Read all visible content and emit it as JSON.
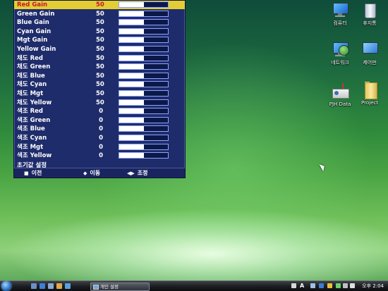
{
  "osd": {
    "items": [
      {
        "label": "Red Gain",
        "value": "50",
        "level": 0.5,
        "selected": true
      },
      {
        "label": "Green Gain",
        "value": "50",
        "level": 0.5
      },
      {
        "label": "Blue Gain",
        "value": "50",
        "level": 0.5
      },
      {
        "label": "Cyan Gain",
        "value": "50",
        "level": 0.5
      },
      {
        "label": "Mgt Gain",
        "value": "50",
        "level": 0.5
      },
      {
        "label": "Yellow Gain",
        "value": "50",
        "level": 0.5
      },
      {
        "label": "채도 Red",
        "value": "50",
        "level": 0.5
      },
      {
        "label": "채도 Green",
        "value": "50",
        "level": 0.5
      },
      {
        "label": "채도 Blue",
        "value": "50",
        "level": 0.5
      },
      {
        "label": "채도 Cyan",
        "value": "50",
        "level": 0.5
      },
      {
        "label": "채도 Mgt",
        "value": "50",
        "level": 0.5
      },
      {
        "label": "채도 Yellow",
        "value": "50",
        "level": 0.5
      },
      {
        "label": "색조 Red",
        "value": "0",
        "level": 0.5
      },
      {
        "label": "색조 Green",
        "value": "0",
        "level": 0.5
      },
      {
        "label": "색조 Blue",
        "value": "0",
        "level": 0.5
      },
      {
        "label": "색조 Cyan",
        "value": "0",
        "level": 0.5
      },
      {
        "label": "색조 Mgt",
        "value": "0",
        "level": 0.5
      },
      {
        "label": "색조 Yellow",
        "value": "0",
        "level": 0.5
      }
    ],
    "reset_label": "초기값 설정",
    "footer": {
      "prev": "이전",
      "move": "이동",
      "adjust": "조정"
    },
    "colors": {
      "background": "#1f2c6b",
      "selected": "#e3cd35",
      "selected_text": "#c9142b"
    }
  },
  "desktop": {
    "icons": [
      {
        "label": "컴퓨터",
        "icon": "computer-icon"
      },
      {
        "label": "휴지통",
        "icon": "recycle-bin-icon"
      },
      {
        "label": "네트워크",
        "icon": "network-icon"
      },
      {
        "label": "제어판",
        "icon": "control-panel-icon"
      },
      {
        "label": "PJH Data",
        "icon": "projector-icon"
      },
      {
        "label": "Project",
        "icon": "folder-icon"
      }
    ]
  },
  "taskbar": {
    "window_title": "개인 설정",
    "language": "A",
    "clock": "오후 2:04"
  }
}
